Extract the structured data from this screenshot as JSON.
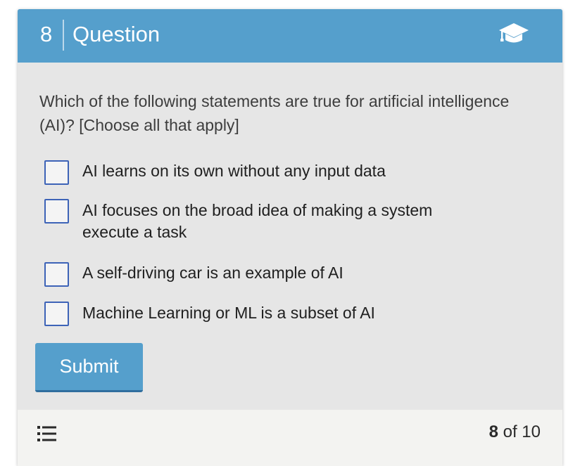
{
  "header": {
    "number": "8",
    "title": "Question",
    "icon": "graduation-cap-icon",
    "background": "#559fcc"
  },
  "question": {
    "prompt": "Which of the following statements are true for artificial intelligence (AI)? [Choose all that apply]",
    "options": [
      {
        "label": "AI learns on its own without any input data",
        "checked": false
      },
      {
        "label": "AI focuses on the broad idea of making a system execute a task",
        "checked": false
      },
      {
        "label": "A self-driving car is an example of AI",
        "checked": false
      },
      {
        "label": "Machine Learning or ML is a subset of AI",
        "checked": false
      }
    ]
  },
  "submit": {
    "label": "Submit"
  },
  "footer": {
    "icon": "list-icon",
    "current": "8",
    "of_text": "of 10"
  }
}
